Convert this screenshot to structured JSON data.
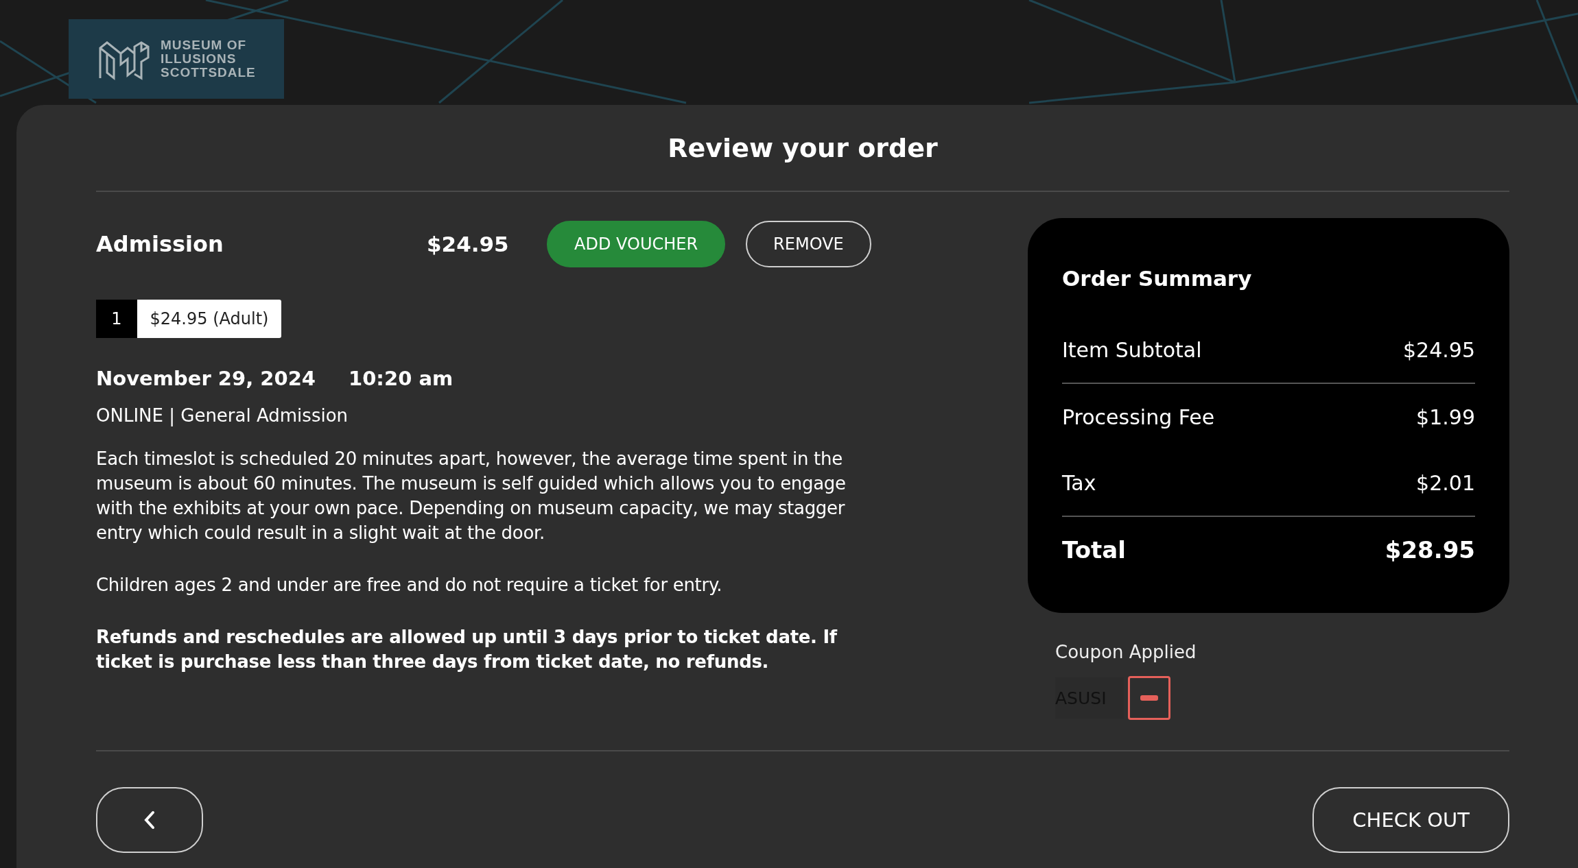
{
  "logo": {
    "lines": [
      "MUSEUM OF",
      "ILLUSIONS",
      "SCOTTSDALE"
    ]
  },
  "title": "Review your order",
  "item": {
    "name": "Admission",
    "price": "$24.95",
    "buttons": [
      {
        "label": "ADD VOUCHER",
        "kind": "primary"
      },
      {
        "label": "REMOVE",
        "kind": "outline"
      }
    ],
    "quantity": "1",
    "ticket": "$24.95 (Adult)",
    "date": "November 29, 2024",
    "time": "10:20 am",
    "type": "ONLINE | General Admission",
    "paragraphs": [
      {
        "text": "Each timeslot is scheduled 20 minutes apart, however, the average time spent in the museum is about 60 minutes.  The museum is self guided which allows you to engage with the exhibits at your own pace.  Depending on museum capacity, we may stagger entry which could result in a slight wait at the door.",
        "bold": false
      },
      {
        "text": "Children ages 2 and under are free and do not require a ticket for entry.",
        "bold": false
      },
      {
        "text": "Refunds and reschedules are allowed up until 3 days prior to ticket date. If ticket is purchase less than three days from ticket date, no refunds.",
        "bold": true
      }
    ]
  },
  "summary": {
    "title": "Order Summary",
    "rows": [
      {
        "label": "Item Subtotal",
        "value": "$24.95",
        "kind": "subtotal"
      },
      {
        "label": "Processing Fee",
        "value": "$1.99",
        "kind": "fee"
      },
      {
        "label": "Tax",
        "value": "$2.01",
        "kind": "fee"
      },
      {
        "label": "Total",
        "value": "$28.95",
        "kind": "total"
      }
    ]
  },
  "coupon": {
    "label": "Coupon Applied",
    "code": "ASUSI"
  },
  "checkout_button": "CHECK OUT"
}
